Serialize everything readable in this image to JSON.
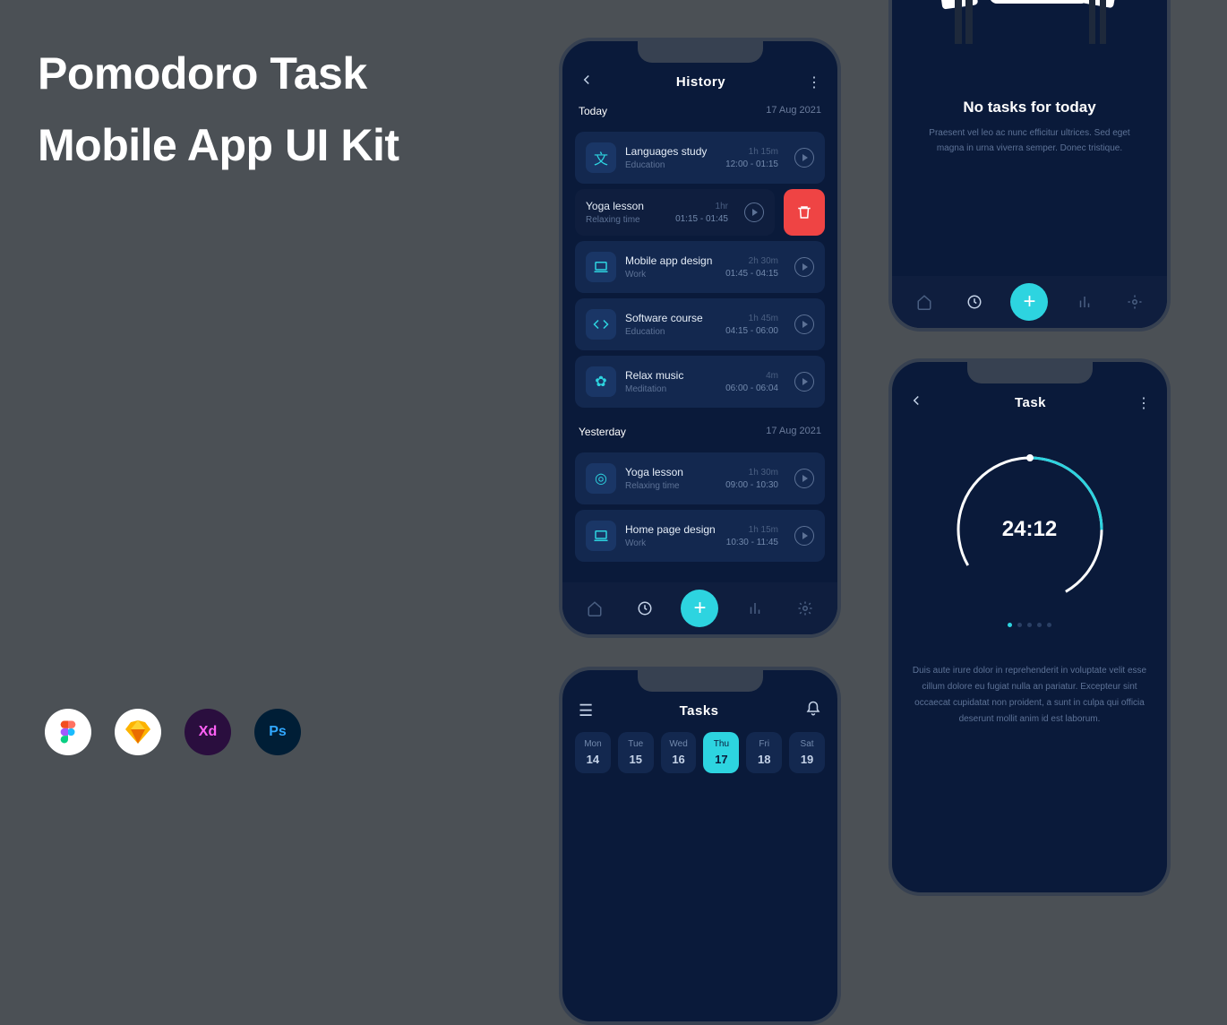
{
  "title_line1": "Pomodoro Task",
  "title_line2": "Mobile App UI Kit",
  "tools": [
    "figma",
    "sketch",
    "xd",
    "photoshop"
  ],
  "history": {
    "header_title": "History",
    "sections": [
      {
        "label": "Today",
        "date": "17 Aug 2021",
        "tasks": [
          {
            "name": "Languages study",
            "category": "Education",
            "duration": "1h 15m",
            "time": "12:00 - 01:15",
            "icon": "language"
          },
          {
            "name": "Yoga lesson",
            "category": "Relaxing time",
            "duration": "1hr",
            "time": "01:15 - 01:45",
            "icon": "yoga",
            "swiped": true
          },
          {
            "name": "Mobile app design",
            "category": "Work",
            "duration": "2h 30m",
            "time": "01:45 - 04:15",
            "icon": "laptop"
          },
          {
            "name": "Software course",
            "category": "Education",
            "duration": "1h 45m",
            "time": "04:15 - 06:00",
            "icon": "code"
          },
          {
            "name": "Relax music",
            "category": "Meditation",
            "duration": "4m",
            "time": "06:00 - 06:04",
            "icon": "lotus"
          }
        ]
      },
      {
        "label": "Yesterday",
        "date": "17 Aug 2021",
        "tasks": [
          {
            "name": "Yoga lesson",
            "category": "Relaxing time",
            "duration": "1h 30m",
            "time": "09:00 - 10:30",
            "icon": "yoga2"
          },
          {
            "name": "Home page design",
            "category": "Work",
            "duration": "1h 15m",
            "time": "10:30 - 11:45",
            "icon": "laptop"
          }
        ]
      }
    ]
  },
  "notasks": {
    "title": "No tasks for today",
    "desc": "Praesent vel leo ac nunc efficitur ultrices. Sed eget magna in urna viverra semper. Donec tristique."
  },
  "tasks_screen": {
    "header_title": "Tasks",
    "days": [
      {
        "dow": "Mon",
        "num": "14"
      },
      {
        "dow": "Tue",
        "num": "15"
      },
      {
        "dow": "Wed",
        "num": "16"
      },
      {
        "dow": "Thu",
        "num": "17",
        "active": true
      },
      {
        "dow": "Fri",
        "num": "18"
      },
      {
        "dow": "Sat",
        "num": "19"
      }
    ]
  },
  "timer": {
    "header_title": "Task",
    "time": "24:12",
    "desc": "Duis aute irure dolor in reprehenderit in voluptate velit esse cillum dolore eu fugiat nulla an pariatur. Excepteur sint occaecat cupidatat non proident, a sunt in culpa qui officia deserunt mollit anim id est laborum."
  }
}
